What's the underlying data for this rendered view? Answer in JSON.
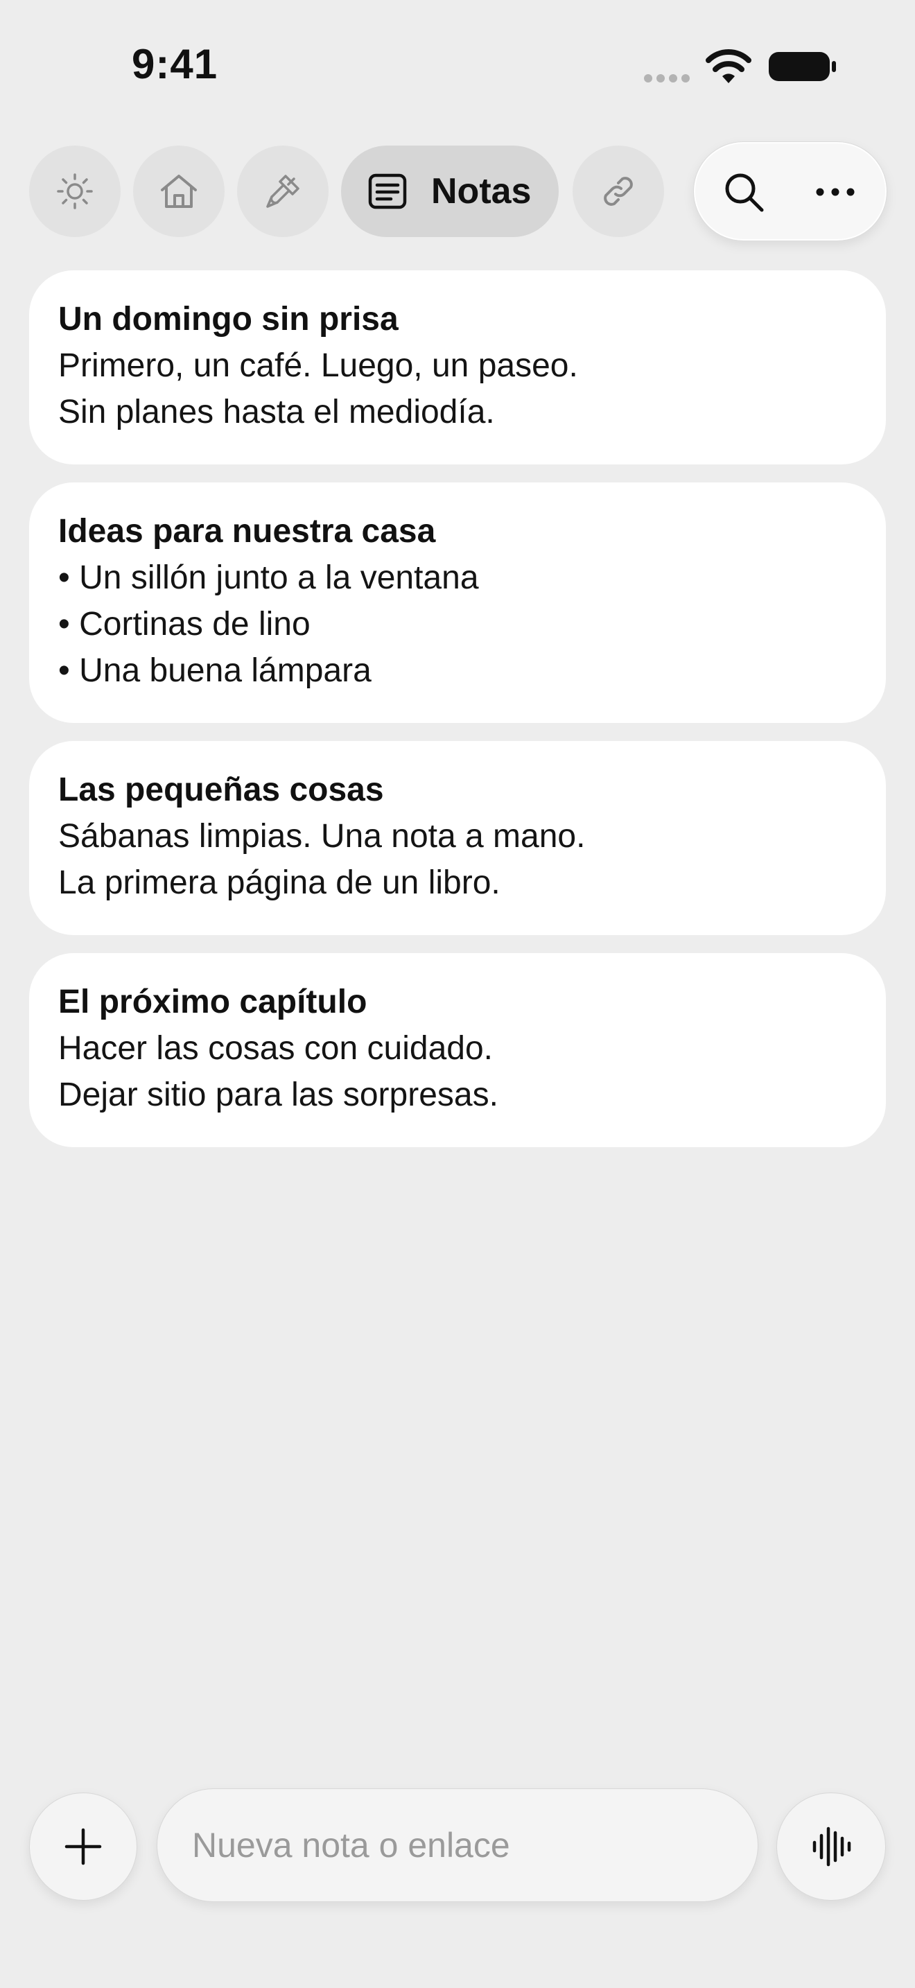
{
  "status_bar": {
    "time": "9:41",
    "icons": [
      "cellular-signal-icon",
      "wifi-icon",
      "battery-icon"
    ]
  },
  "nav": {
    "items": [
      {
        "icon": "sun-icon"
      },
      {
        "icon": "home-icon"
      },
      {
        "icon": "paintbrush-icon"
      },
      {
        "icon": "notes-icon",
        "label": "Notas",
        "active": true
      },
      {
        "icon": "link-icon"
      }
    ],
    "actions": [
      "search-icon",
      "more-icon"
    ]
  },
  "notes": [
    {
      "title": "Un domingo sin prisa",
      "lines": [
        "Primero, un café. Luego, un paseo.",
        "Sin planes hasta el mediodía."
      ]
    },
    {
      "title": "Ideas para nuestra casa",
      "lines": [
        "• Un sillón junto a la ventana",
        "• Cortinas de lino",
        "• Una buena lámpara"
      ]
    },
    {
      "title": "Las pequeñas cosas",
      "lines": [
        "Sábanas limpias. Una nota a mano.",
        "La primera página de un libro."
      ]
    },
    {
      "title": "El próximo capítulo",
      "lines": [
        "Hacer las cosas con cuidado.",
        "Dejar sitio para las sorpresas."
      ]
    }
  ],
  "composer": {
    "placeholder": "Nueva nota o enlace",
    "value": ""
  },
  "colors": {
    "background": "#ededed",
    "card": "#ffffff",
    "nav_button": "#e2e2e2",
    "nav_active": "#d6d6d6",
    "icon_muted": "#8a8a8a",
    "text": "#111111"
  }
}
